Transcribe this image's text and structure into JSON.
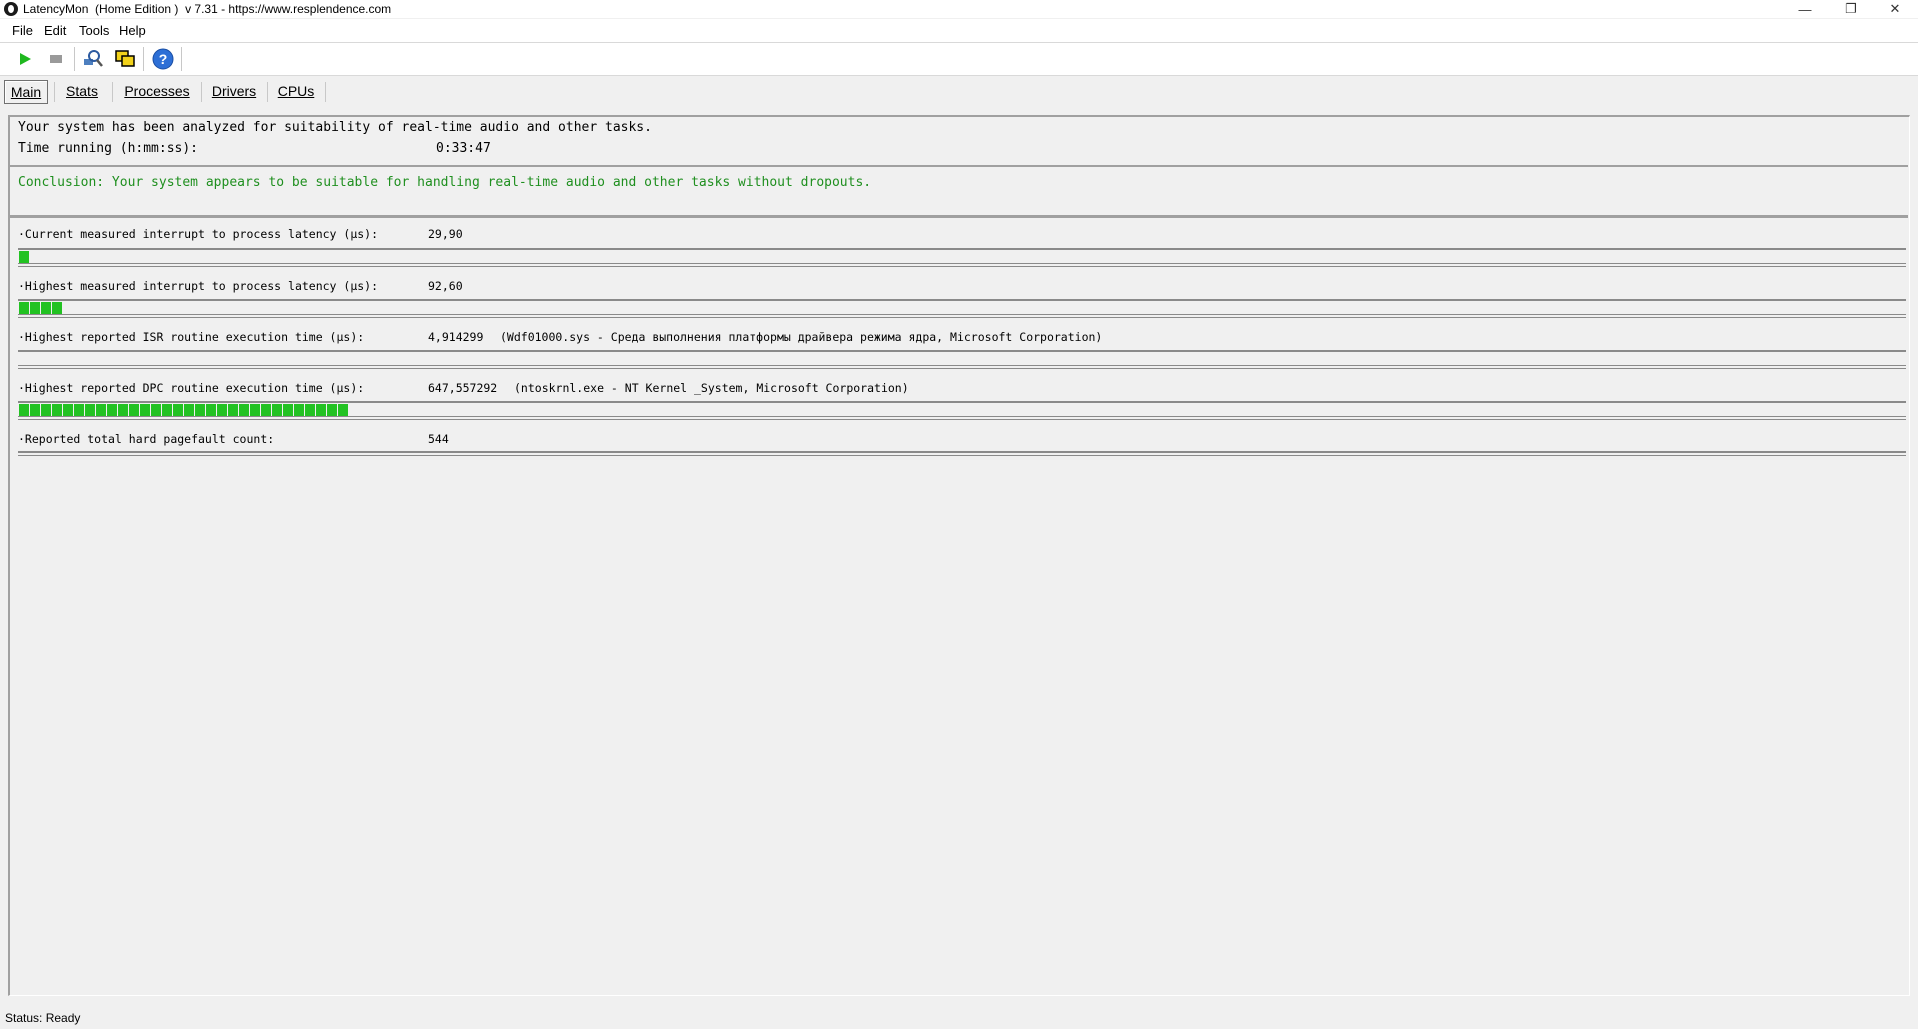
{
  "window": {
    "title": "LatencyMon  (Home Edition )  v 7.31 - https://www.resplendence.com",
    "minimize_glyph": "—",
    "restore_glyph": "❐",
    "close_glyph": "✕"
  },
  "menu": [
    "File",
    "Edit",
    "Tools",
    "Help"
  ],
  "toolbar": {
    "icons": [
      "play-icon",
      "stop-icon",
      "search-tool-icon",
      "windows-icon",
      "help-icon"
    ]
  },
  "tabs": [
    "Main",
    "Stats",
    "Processes",
    "Drivers",
    "CPUs"
  ],
  "header": {
    "line1": "Your system has been analyzed for suitability of real-time audio and other tasks.",
    "time_label": "Time running (h:mm:ss):",
    "time_value": "0:33:47"
  },
  "conclusion": "Conclusion: Your system appears to be suitable for handling real-time audio and other tasks without dropouts.",
  "metrics": [
    {
      "label": "·Current measured interrupt to process latency (µs):",
      "value": "29,90",
      "extra": "",
      "bar_segments": 1
    },
    {
      "label": "·Highest measured interrupt to process latency (µs):",
      "value": "92,60",
      "extra": "",
      "bar_segments": 4
    },
    {
      "label": "·Highest reported ISR routine execution time (µs):",
      "value": "4,914299",
      "extra": "(Wdf01000.sys - Среда выполнения платформы драйвера режима ядра, Microsoft Corporation)",
      "bar_segments": 0
    },
    {
      "label": "·Highest reported DPC routine execution time (µs):",
      "value": "647,557292",
      "extra": "(ntoskrnl.exe - NT Kernel _System, Microsoft Corporation)",
      "bar_segments": 30
    },
    {
      "label": "·Reported total hard pagefault count:",
      "value": "544",
      "extra": ""
    }
  ],
  "status": "Status: Ready",
  "colors": {
    "conclusion_green": "#1f8f1f",
    "bar_green": "#22c222"
  }
}
